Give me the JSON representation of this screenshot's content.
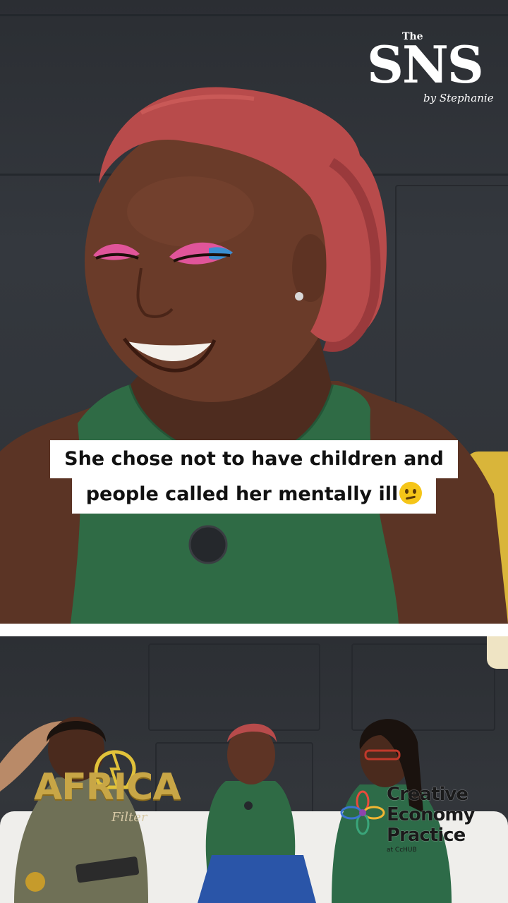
{
  "top_video": {
    "caption_line_1": "She chose not to have children and",
    "caption_line_2": "people called her mentally ill",
    "caption_emoji": "confused-face-emoji",
    "logo": {
      "the": "The",
      "main": "SNS",
      "by": "by Stephanie"
    }
  },
  "bottom_video": {
    "africa_logo": {
      "main": "AFRICA",
      "sub": "Filter"
    },
    "creative_logo": {
      "line_1": "Creative",
      "line_2": "Economy",
      "line_3": "Practice",
      "sub": "at CcHUB"
    }
  },
  "colors": {
    "caption_bg": "#ffffff",
    "caption_text": "#111111",
    "wall": "#2f3237",
    "top_outfit": "#2f6b45",
    "hair": "#b84b4b",
    "africa_gold": "#c8a646"
  }
}
